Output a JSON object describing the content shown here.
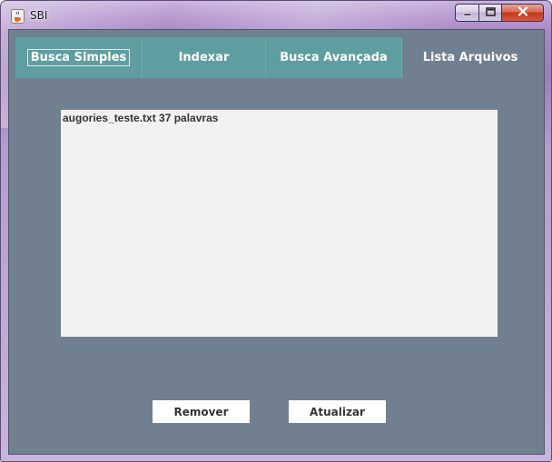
{
  "window": {
    "title": "SBI",
    "icon": "java-cup-icon",
    "controls": {
      "minimize": "minimize-icon",
      "maximize": "maximize-icon",
      "close": "close-icon"
    }
  },
  "tabs": [
    {
      "label": "Busca Simples",
      "active": false,
      "focused": true
    },
    {
      "label": "Indexar",
      "active": false,
      "focused": false
    },
    {
      "label": "Busca Avançada",
      "active": false,
      "focused": false
    },
    {
      "label": "Lista Arquivos",
      "active": true,
      "focused": false
    }
  ],
  "file_list": {
    "items": [
      {
        "text": "augories_teste.txt 37 palavras"
      }
    ]
  },
  "buttons": {
    "remove_label": "Remover",
    "refresh_label": "Atualizar"
  },
  "colors": {
    "tab_background": "#5f9ea0",
    "panel_background": "#708090",
    "list_background": "#f2f2f2"
  }
}
